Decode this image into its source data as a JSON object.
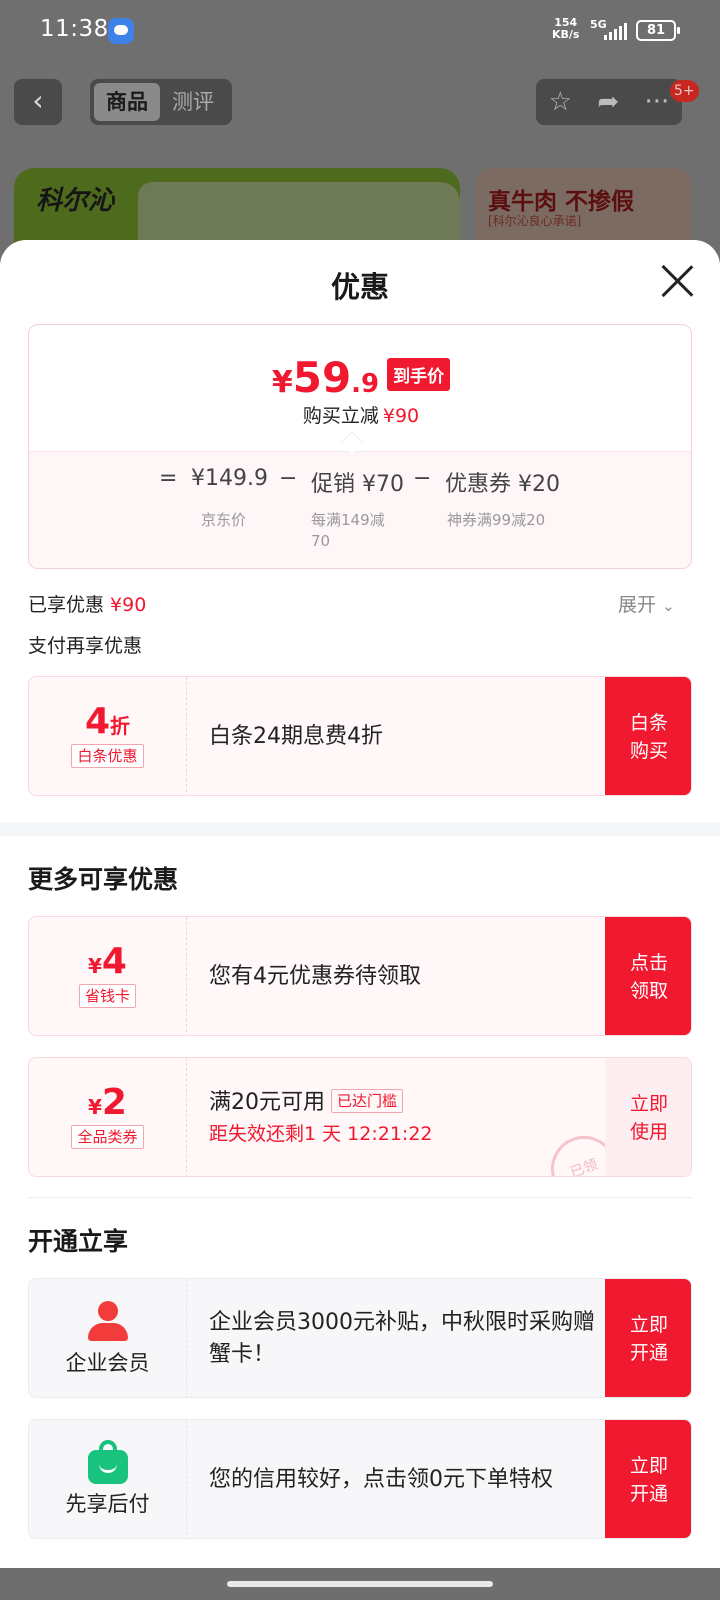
{
  "status_bar": {
    "time": "11:38",
    "speed_value": "154",
    "speed_unit": "KB/s",
    "network": "5G",
    "battery": "81"
  },
  "nav": {
    "tabs": [
      "商品",
      "测评"
    ],
    "badge": "5+"
  },
  "banner": {
    "logo": "科尔沁",
    "right_title": "真牛肉 不掺假",
    "right_sub": "[科尔沁良心承诺]"
  },
  "sheet": {
    "title": "优惠",
    "price": {
      "symbol": "¥",
      "integer": "59",
      "decimal": ".9",
      "tag": "到手价",
      "save_label": "购买立减",
      "save_value": "¥90"
    },
    "calc": {
      "equals": "=",
      "jd_price": "¥149.9",
      "jd_label": "京东价",
      "minus1": "−",
      "promo": "促销 ¥70",
      "promo_sub_1": "每满149减",
      "promo_sub_2": "70",
      "minus2": "−",
      "coupon": "优惠券 ¥20",
      "coupon_sub": "神券满99减20"
    },
    "enjoyed_label": "已享优惠",
    "enjoyed_value": "¥90",
    "expand_label": "展开",
    "pay_more_label": "支付再享优惠",
    "baitiao": {
      "amount": "4",
      "unit": "折",
      "label": "白条优惠",
      "text": "白条24期息费4折",
      "button_1": "白条",
      "button_2": "购买"
    },
    "more_section_title": "更多可享优惠",
    "coupon1": {
      "symbol": "¥",
      "amount": "4",
      "label": "省钱卡",
      "text": "您有4元优惠券待领取",
      "button_1": "点击",
      "button_2": "领取"
    },
    "coupon2": {
      "symbol": "¥",
      "amount": "2",
      "label": "全品类券",
      "condition": "满20元可用",
      "condition_tag": "已达门槛",
      "countdown": "距失效还剩1 天 12:21:22",
      "stamp": "已领",
      "button_1": "立即",
      "button_2": "使用"
    },
    "open_section_title": "开通立享",
    "enterprise": {
      "name": "企业会员",
      "text": "企业会员3000元补贴，中秋限时采购赠蟹卡！",
      "button_1": "立即",
      "button_2": "开通"
    },
    "paylater": {
      "name": "先享后付",
      "text": "您的信用较好，点击领0元下单特权",
      "button_1": "立即",
      "button_2": "开通"
    }
  },
  "colors": {
    "accent_red": "#f0192f",
    "green": "#19c37d"
  }
}
